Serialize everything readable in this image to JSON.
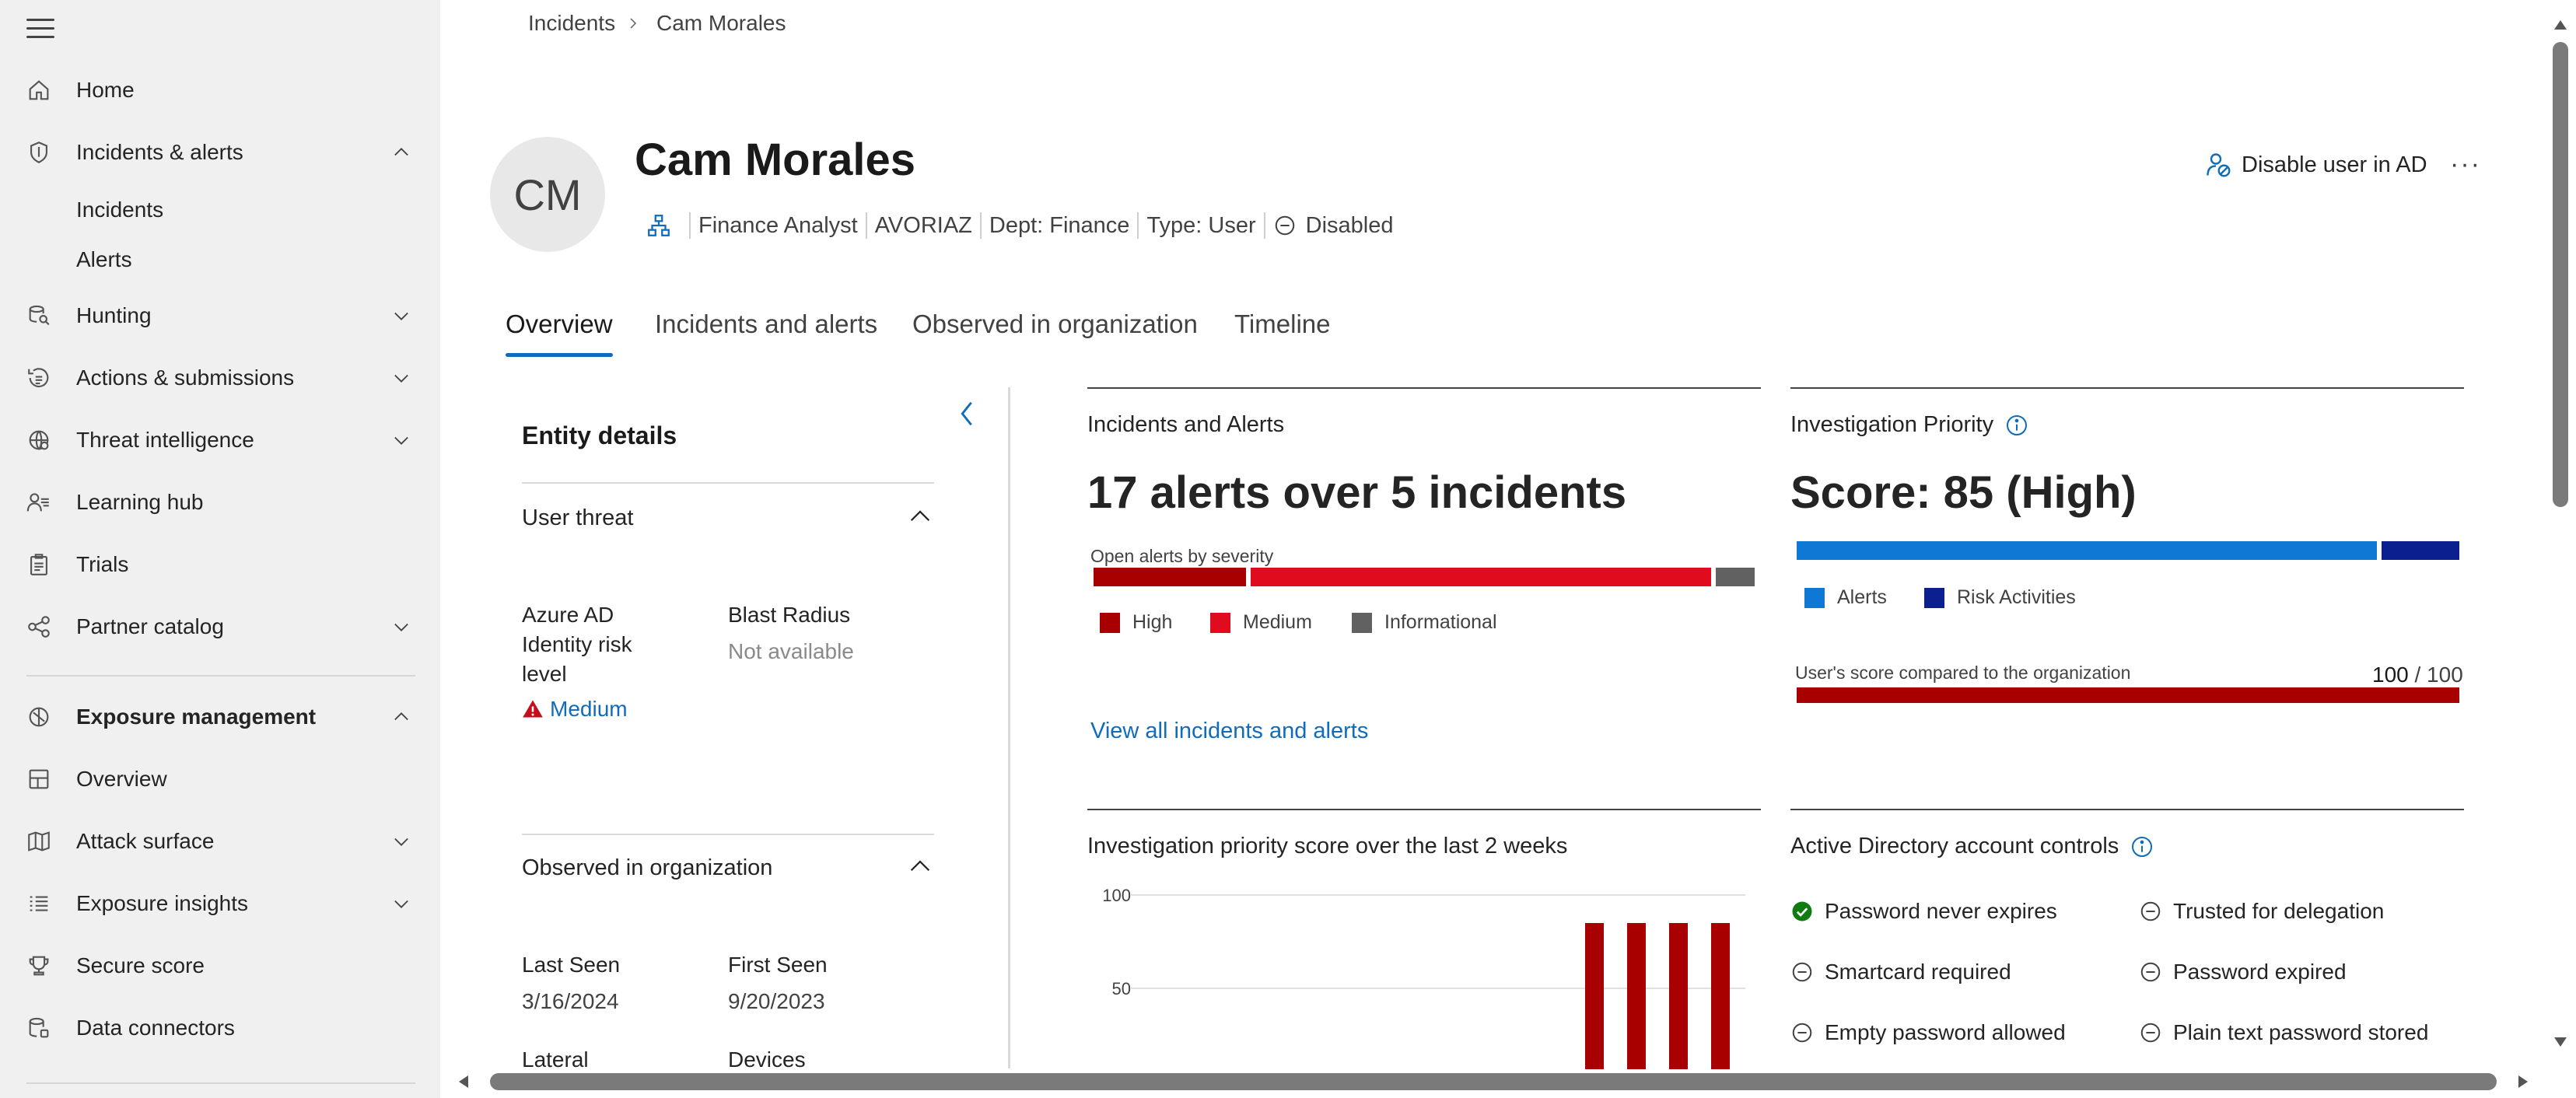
{
  "sidebar": {
    "items": [
      {
        "label": "Home",
        "icon": "home-icon"
      },
      {
        "label": "Incidents & alerts",
        "icon": "shield-icon",
        "expanded": true
      },
      {
        "label": "Incidents"
      },
      {
        "label": "Alerts"
      },
      {
        "label": "Hunting",
        "icon": "hunting-icon"
      },
      {
        "label": "Actions & submissions",
        "icon": "actions-icon"
      },
      {
        "label": "Threat intelligence",
        "icon": "threat-intel-icon"
      },
      {
        "label": "Learning hub",
        "icon": "learning-icon"
      },
      {
        "label": "Trials",
        "icon": "trials-icon"
      },
      {
        "label": "Partner catalog",
        "icon": "partner-icon"
      },
      {
        "label": "Exposure management",
        "icon": "exposure-icon",
        "expanded": true
      },
      {
        "label": "Overview",
        "icon": "overview-icon"
      },
      {
        "label": "Attack surface",
        "icon": "map-icon"
      },
      {
        "label": "Exposure insights",
        "icon": "list-icon"
      },
      {
        "label": "Secure score",
        "icon": "trophy-icon"
      },
      {
        "label": "Data connectors",
        "icon": "connectors-icon"
      }
    ]
  },
  "breadcrumb": {
    "root": "Incidents",
    "current": "Cam Morales"
  },
  "user": {
    "initials": "CM",
    "name": "Cam Morales",
    "role": "Finance Analyst",
    "domain": "AVORIAZ",
    "dept": "Dept: Finance",
    "type": "Type: User",
    "status": "Disabled"
  },
  "actions": {
    "disable": "Disable user in AD",
    "more": "···"
  },
  "tabs": [
    "Overview",
    "Incidents and alerts",
    "Observed in organization",
    "Timeline"
  ],
  "entity_details": {
    "title": "Entity details",
    "user_threat": {
      "title": "User threat",
      "azure_label": "Azure AD Identity risk level",
      "azure_value": "Medium",
      "blast_label": "Blast Radius",
      "blast_value": "Not available"
    },
    "observed": {
      "title": "Observed in organization",
      "last_seen_label": "Last Seen",
      "last_seen_value": "3/16/2024",
      "first_seen_label": "First Seen",
      "first_seen_value": "9/20/2023",
      "lateral_label": "Lateral",
      "devices_label": "Devices"
    }
  },
  "incidents_card": {
    "title": "Incidents and Alerts",
    "metric": "17 alerts over 5 incidents",
    "severity_label": "Open alerts by severity",
    "legend": [
      "High",
      "Medium",
      "Informational"
    ],
    "colors": {
      "high": "#a80000",
      "medium": "#e00b1c",
      "informational": "#616161"
    },
    "link": "View all incidents and alerts"
  },
  "priority_card": {
    "title": "Investigation Priority",
    "metric": "Score: 85 (High)",
    "legend": [
      "Alerts",
      "Risk Activities"
    ],
    "colors": {
      "alerts": "#0f78d4",
      "risk": "#0b1f8f"
    },
    "compare_label": "User's score compared to the organization",
    "compare_score": "100",
    "compare_total": "/ 100"
  },
  "trend_card": {
    "title": "Investigation priority score over the last 2 weeks"
  },
  "ad_card": {
    "title": "Active Directory account controls",
    "items": [
      {
        "label": "Password never expires",
        "state": "on"
      },
      {
        "label": "Trusted for delegation",
        "state": "off"
      },
      {
        "label": "Smartcard required",
        "state": "off"
      },
      {
        "label": "Password expired",
        "state": "off"
      },
      {
        "label": "Empty password allowed",
        "state": "off"
      },
      {
        "label": "Plain text password stored",
        "state": "off"
      }
    ]
  },
  "chart_data": {
    "type": "bar",
    "title": "Investigation priority score over the last 2 weeks",
    "yticks": [
      100,
      50
    ],
    "ylim": [
      0,
      100
    ],
    "series": [
      {
        "values": [
          85,
          85,
          85,
          85
        ]
      }
    ],
    "color": "#a80000"
  }
}
